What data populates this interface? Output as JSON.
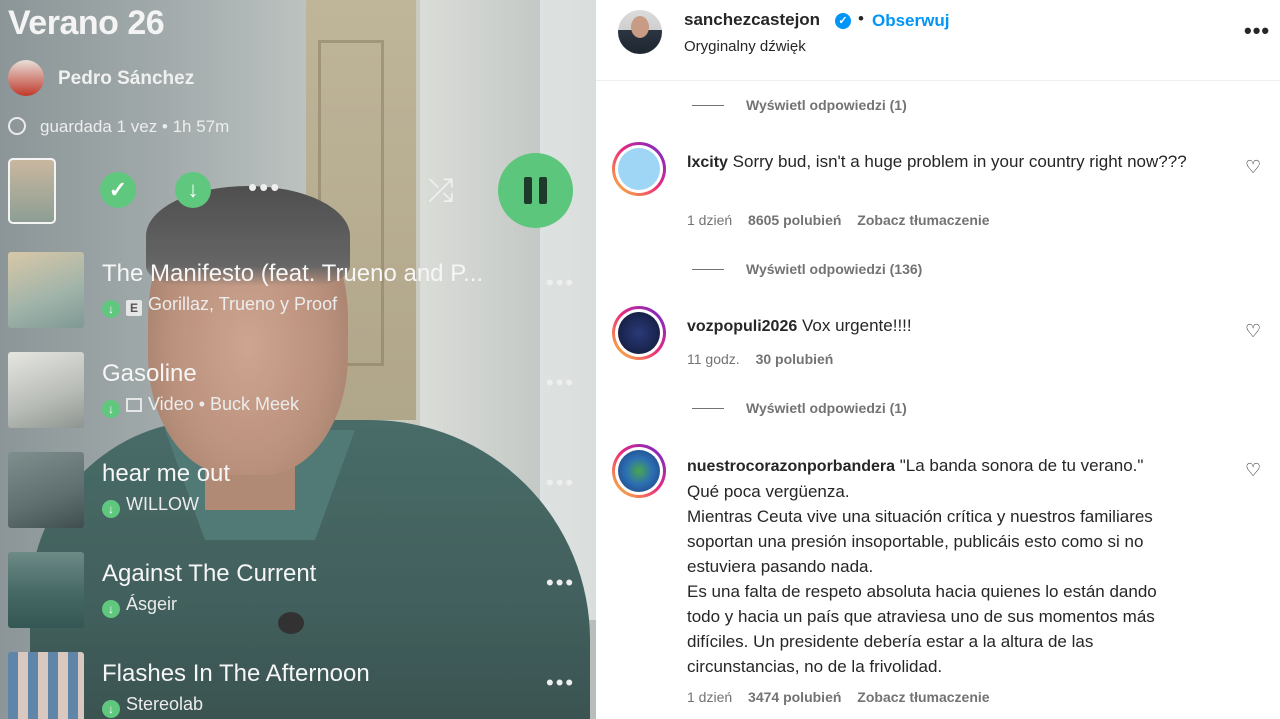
{
  "playlist": {
    "title": "Verano 26",
    "owner": "Pedro Sánchez",
    "meta": "guardada 1 vez • 1h 57m",
    "controls": {
      "more": "•••"
    },
    "tracks": [
      {
        "name": "The Manifesto (feat. Trueno and P...",
        "artists": "Gorillaz, Trueno y Proof",
        "badge": "E"
      },
      {
        "name": "Gasoline",
        "artists": "Video • Buck Meek",
        "badge": "video"
      },
      {
        "name": "hear me out",
        "artists": "WILLOW",
        "badge": ""
      },
      {
        "name": "Against The Current",
        "artists": "Ásgeir",
        "badge": ""
      },
      {
        "name": "Flashes In The Afternoon",
        "artists": "Stereolab",
        "badge": ""
      }
    ],
    "track_more": "•••"
  },
  "post": {
    "username": "sanchezcastejon",
    "verified_icon": "✓",
    "dot": "•",
    "follow_label": "Obserwuj",
    "audio": "Oryginalny dźwięk",
    "more": "•••"
  },
  "comments": {
    "replies_top": "Wyświetl odpowiedzi (1)",
    "items": [
      {
        "user": "lxcity",
        "text": "Sorry bud, isn't a huge problem in your country right now???",
        "time": "1 dzień",
        "likes": "8605 polubień",
        "translate": "Zobacz tłumaczenie",
        "replies": "Wyświetl odpowiedzi (136)"
      },
      {
        "user": "vozpopuli2026",
        "text": "Vox urgente!!!!",
        "time": "11 godz.",
        "likes": "30 polubień",
        "translate": "",
        "replies": "Wyświetl odpowiedzi (1)"
      },
      {
        "user": "nuestrocorazonporbandera",
        "text_first": "\"La banda sonora de tu verano.\"",
        "lines": [
          "Qué poca vergüenza.",
          "Mientras Ceuta vive una situación crítica y nuestros familiares",
          "soportan una presión insoportable, publicáis esto como si no",
          "estuviera pasando nada.",
          "Es una falta de respeto absoluta hacia quienes lo están dando",
          "todo y hacia un país que atraviesa uno de sus momentos más",
          "difíciles. Un presidente debería estar a la altura de las",
          "circunstancias, no de la frivolidad."
        ],
        "time": "1 dzień",
        "likes": "3474 polubień",
        "translate": "Zobacz tłumaczenie"
      }
    ],
    "heart_icon": "♡"
  },
  "colors": {
    "accent_green": "#5fc77e",
    "ig_blue": "#0095f6",
    "text_dark": "#262626",
    "text_muted": "#737373"
  }
}
